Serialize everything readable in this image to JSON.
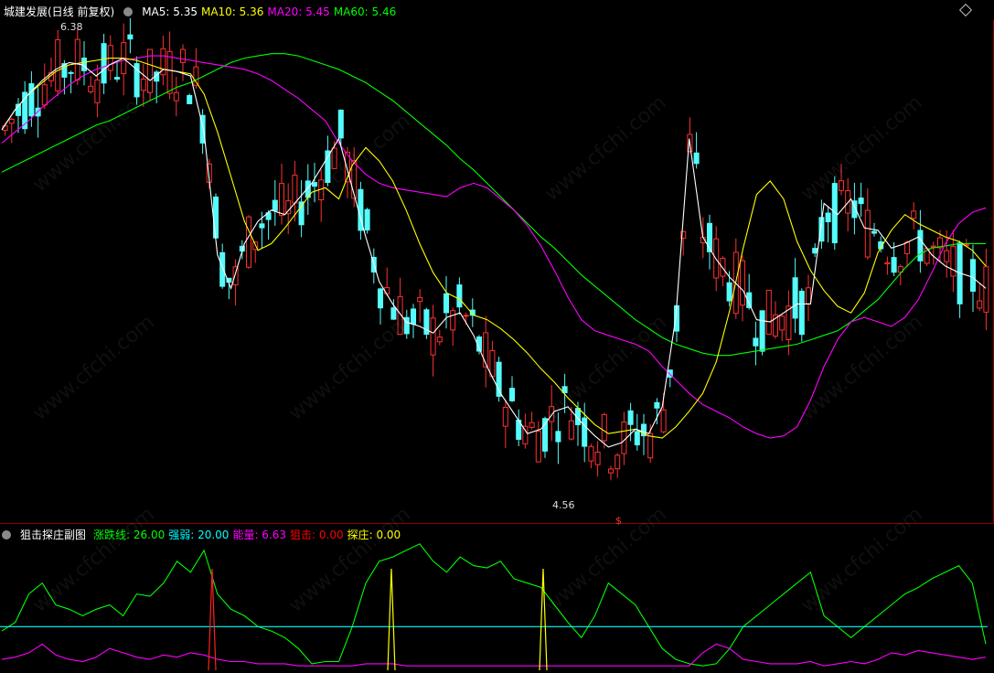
{
  "top_panel": {
    "title": "城建发展(日线 前复权)",
    "legend": [
      {
        "label": "MA5: 5.35",
        "color": "#ffffff"
      },
      {
        "label": "MA10: 5.36",
        "color": "#ffff00"
      },
      {
        "label": "MA20: 5.45",
        "color": "#ff00ff"
      },
      {
        "label": "MA60: 5.46",
        "color": "#00ff00"
      }
    ],
    "high_label": "6.38",
    "low_label": "4.56",
    "signal_mark": "$"
  },
  "bottom_panel": {
    "title": "狙击探庄副图",
    "legend": [
      {
        "label": "涨跌线: 26.00",
        "color": "#00ff00"
      },
      {
        "label": "强弱: 20.00",
        "color": "#00ffff"
      },
      {
        "label": "能量: 6.63",
        "color": "#ff00ff"
      },
      {
        "label": "狙击: 0.00",
        "color": "#ff0000"
      },
      {
        "label": "探庄: 0.00",
        "color": "#ffff00"
      }
    ]
  },
  "watermark": "www.cfchi.com",
  "colors": {
    "up": "#ff3030",
    "down": "#54fcfc",
    "ma5": "#ffffff",
    "ma10": "#ffff00",
    "ma20": "#ff00ff",
    "ma60": "#00ff00"
  },
  "chart_data": [
    {
      "type": "candlestick",
      "ylim": [
        4.3,
        6.55
      ],
      "series": [
        {
          "name": "MA60",
          "values": [
            5.87,
            5.9,
            5.93,
            5.96,
            5.99,
            6.02,
            6.05,
            6.08,
            6.1,
            6.13,
            6.16,
            6.19,
            6.22,
            6.25,
            6.27,
            6.3,
            6.33,
            6.36,
            6.38,
            6.39,
            6.4,
            6.4,
            6.39,
            6.37,
            6.35,
            6.33,
            6.3,
            6.27,
            6.23,
            6.19,
            6.14,
            6.09,
            6.04,
            5.99,
            5.93,
            5.88,
            5.82,
            5.76,
            5.7,
            5.64,
            5.58,
            5.53,
            5.47,
            5.41,
            5.36,
            5.31,
            5.26,
            5.21,
            5.17,
            5.13,
            5.1,
            5.08,
            5.06,
            5.05,
            5.05,
            5.06,
            5.07,
            5.08,
            5.09,
            5.1,
            5.12,
            5.14,
            5.16,
            5.2,
            5.25,
            5.3,
            5.37,
            5.44,
            5.5,
            5.53,
            5.54,
            5.55,
            5.55,
            5.55
          ]
        },
        {
          "name": "MA20",
          "values": [
            6.0,
            6.05,
            6.1,
            6.16,
            6.21,
            6.26,
            6.3,
            6.33,
            6.35,
            6.37,
            6.38,
            6.39,
            6.39,
            6.38,
            6.37,
            6.36,
            6.35,
            6.34,
            6.33,
            6.31,
            6.28,
            6.24,
            6.2,
            6.15,
            6.1,
            6.0,
            5.92,
            5.86,
            5.82,
            5.8,
            5.79,
            5.78,
            5.77,
            5.76,
            5.8,
            5.82,
            5.8,
            5.75,
            5.7,
            5.63,
            5.54,
            5.43,
            5.31,
            5.21,
            5.16,
            5.14,
            5.12,
            5.1,
            5.07,
            5.0,
            4.94,
            4.88,
            4.83,
            4.8,
            4.77,
            4.73,
            4.7,
            4.68,
            4.69,
            4.73,
            4.85,
            5.0,
            5.12,
            5.2,
            5.22,
            5.2,
            5.18,
            5.22,
            5.3,
            5.42,
            5.55,
            5.64,
            5.69,
            5.71
          ]
        },
        {
          "name": "MA10",
          "values": [
            6.06,
            6.15,
            6.22,
            6.27,
            6.32,
            6.35,
            6.36,
            6.37,
            6.38,
            6.38,
            6.37,
            6.35,
            6.33,
            6.32,
            6.31,
            6.22,
            6.05,
            5.85,
            5.65,
            5.52,
            5.55,
            5.62,
            5.7,
            5.78,
            5.8,
            5.75,
            5.9,
            5.98,
            5.92,
            5.83,
            5.7,
            5.55,
            5.42,
            5.33,
            5.3,
            5.23,
            5.21,
            5.17,
            5.12,
            5.06,
            4.99,
            4.93,
            4.86,
            4.8,
            4.74,
            4.7,
            4.71,
            4.72,
            4.69,
            4.68,
            4.73,
            4.8,
            4.88,
            5.02,
            5.25,
            5.53,
            5.77,
            5.83,
            5.75,
            5.56,
            5.43,
            5.34,
            5.27,
            5.24,
            5.33,
            5.51,
            5.61,
            5.68,
            5.64,
            5.61,
            5.58,
            5.56,
            5.52,
            5.45
          ]
        },
        {
          "name": "MA5",
          "values": [
            6.06,
            6.15,
            6.22,
            6.28,
            6.33,
            6.36,
            6.35,
            6.3,
            6.35,
            6.38,
            6.33,
            6.28,
            6.33,
            6.32,
            6.3,
            6.05,
            5.5,
            5.35,
            5.55,
            5.65,
            5.7,
            5.68,
            5.75,
            5.82,
            5.92,
            6.02,
            5.8,
            5.58,
            5.38,
            5.28,
            5.2,
            5.18,
            5.15,
            5.22,
            5.24,
            5.14,
            5.0,
            4.88,
            4.79,
            4.7,
            4.72,
            4.8,
            4.82,
            4.75,
            4.69,
            4.64,
            4.66,
            4.72,
            4.7,
            4.82,
            5.22,
            6.02,
            5.58,
            5.48,
            5.4,
            5.34,
            5.21,
            5.2,
            5.24,
            5.28,
            5.28,
            5.73,
            5.68,
            5.75,
            5.62,
            5.61,
            5.53,
            5.55,
            5.58,
            5.5,
            5.45,
            5.42,
            5.4,
            5.35
          ]
        }
      ]
    },
    {
      "type": "line",
      "series": [
        {
          "name": "涨跌线",
          "values": [
            18,
            22,
            35,
            40,
            30,
            28,
            25,
            28,
            30,
            25,
            35,
            34,
            40,
            50,
            45,
            55,
            35,
            28,
            25,
            20,
            18,
            15,
            10,
            3,
            4,
            4,
            20,
            40,
            50,
            52,
            55,
            58,
            50,
            45,
            52,
            48,
            47,
            50,
            42,
            40,
            38,
            30,
            22,
            15,
            25,
            40,
            35,
            30,
            20,
            10,
            5,
            3,
            2,
            3,
            10,
            20,
            25,
            30,
            35,
            40,
            45,
            25,
            20,
            15,
            20,
            25,
            30,
            35,
            38,
            42,
            45,
            48,
            40,
            12
          ]
        },
        {
          "name": "强弱",
          "values": [
            20
          ]
        },
        {
          "name": "能量",
          "values": [
            5,
            6,
            8,
            12,
            7,
            5,
            4,
            6,
            10,
            8,
            6,
            5,
            7,
            6,
            8,
            7,
            5,
            4,
            4,
            3,
            3,
            3,
            2,
            2,
            2,
            2,
            2,
            3,
            3,
            3,
            2,
            2,
            2,
            2,
            2,
            2,
            2,
            2,
            2,
            2,
            2,
            2,
            2,
            2,
            2,
            2,
            2,
            2,
            2,
            2,
            2,
            2,
            8,
            12,
            10,
            5,
            4,
            3,
            3,
            3,
            4,
            2,
            3,
            4,
            3,
            5,
            8,
            7,
            9,
            8,
            7,
            6,
            5,
            6
          ]
        }
      ]
    }
  ]
}
